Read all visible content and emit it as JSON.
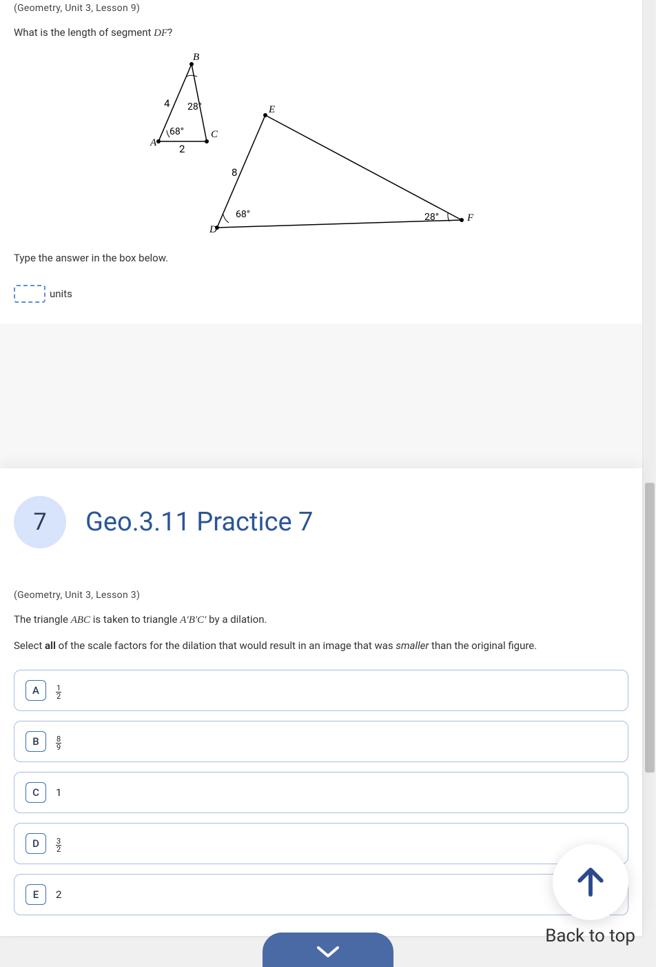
{
  "section1": {
    "meta": "(Geometry, Unit 3, Lesson 9)",
    "question_prefix": "What is the length of segment ",
    "question_segment": "DF",
    "question_suffix": "?",
    "figure": {
      "labels": {
        "A": "A",
        "B": "B",
        "C": "C",
        "D": "D",
        "E": "E",
        "F": "F"
      },
      "values": {
        "AB": "4",
        "AC_bottom": "2",
        "angB": "28°",
        "angA": "68°",
        "DE": "8",
        "angD": "68°",
        "angF": "28°"
      }
    },
    "instruction": "Type the answer in the box below.",
    "units_label": "units"
  },
  "section2": {
    "badge": "7",
    "title": "Geo.3.11 Practice 7",
    "meta": "(Geometry, Unit 3, Lesson 3)",
    "q_prefix": "The triangle ",
    "q_abc": "ABC",
    "q_mid": "  is taken to triangle ",
    "q_abc2": "A′B′C′",
    "q_suffix": "  by a dilation.",
    "instr_prefix": "Select ",
    "instr_bold": "all",
    "instr_mid": " of the scale factors for the dilation that would result in an image that was ",
    "instr_em": "smaller",
    "instr_suffix": " than the original figure.",
    "choices": [
      {
        "letter": "A",
        "type": "frac",
        "n": "1",
        "d": "2"
      },
      {
        "letter": "B",
        "type": "frac",
        "n": "8",
        "d": "9"
      },
      {
        "letter": "C",
        "type": "plain",
        "val": "1"
      },
      {
        "letter": "D",
        "type": "frac",
        "n": "3",
        "d": "2"
      },
      {
        "letter": "E",
        "type": "plain",
        "val": "2"
      }
    ]
  },
  "backtotop": "Back to top"
}
